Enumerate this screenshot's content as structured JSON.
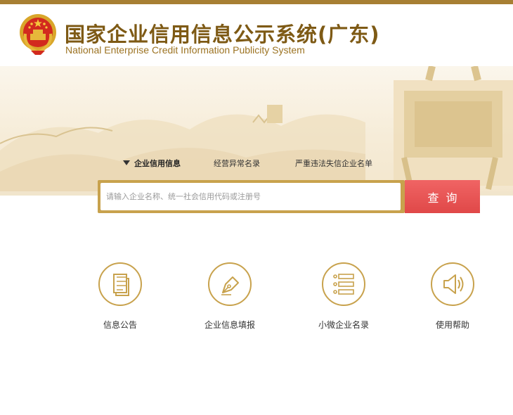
{
  "header": {
    "title_cn": "国家企业信用信息公示系统(广东)",
    "title_en": "National Enterprise Credit Information Publicity System"
  },
  "tabs": [
    {
      "label": "企业信用信息",
      "active": true
    },
    {
      "label": "经营异常名录",
      "active": false
    },
    {
      "label": "严重违法失信企业名单",
      "active": false
    }
  ],
  "search": {
    "placeholder": "请输入企业名称、统一社会信用代码或注册号",
    "value": "",
    "button_label": "查询"
  },
  "features": [
    {
      "label": "信息公告",
      "icon": "document-icon"
    },
    {
      "label": "企业信息填报",
      "icon": "pen-nib-icon"
    },
    {
      "label": "小微企业名录",
      "icon": "list-icon"
    },
    {
      "label": "使用帮助",
      "icon": "speaker-icon"
    }
  ],
  "colors": {
    "gold": "#c8a24d",
    "brown_title": "#7e5a15",
    "search_button": "#e85454"
  }
}
